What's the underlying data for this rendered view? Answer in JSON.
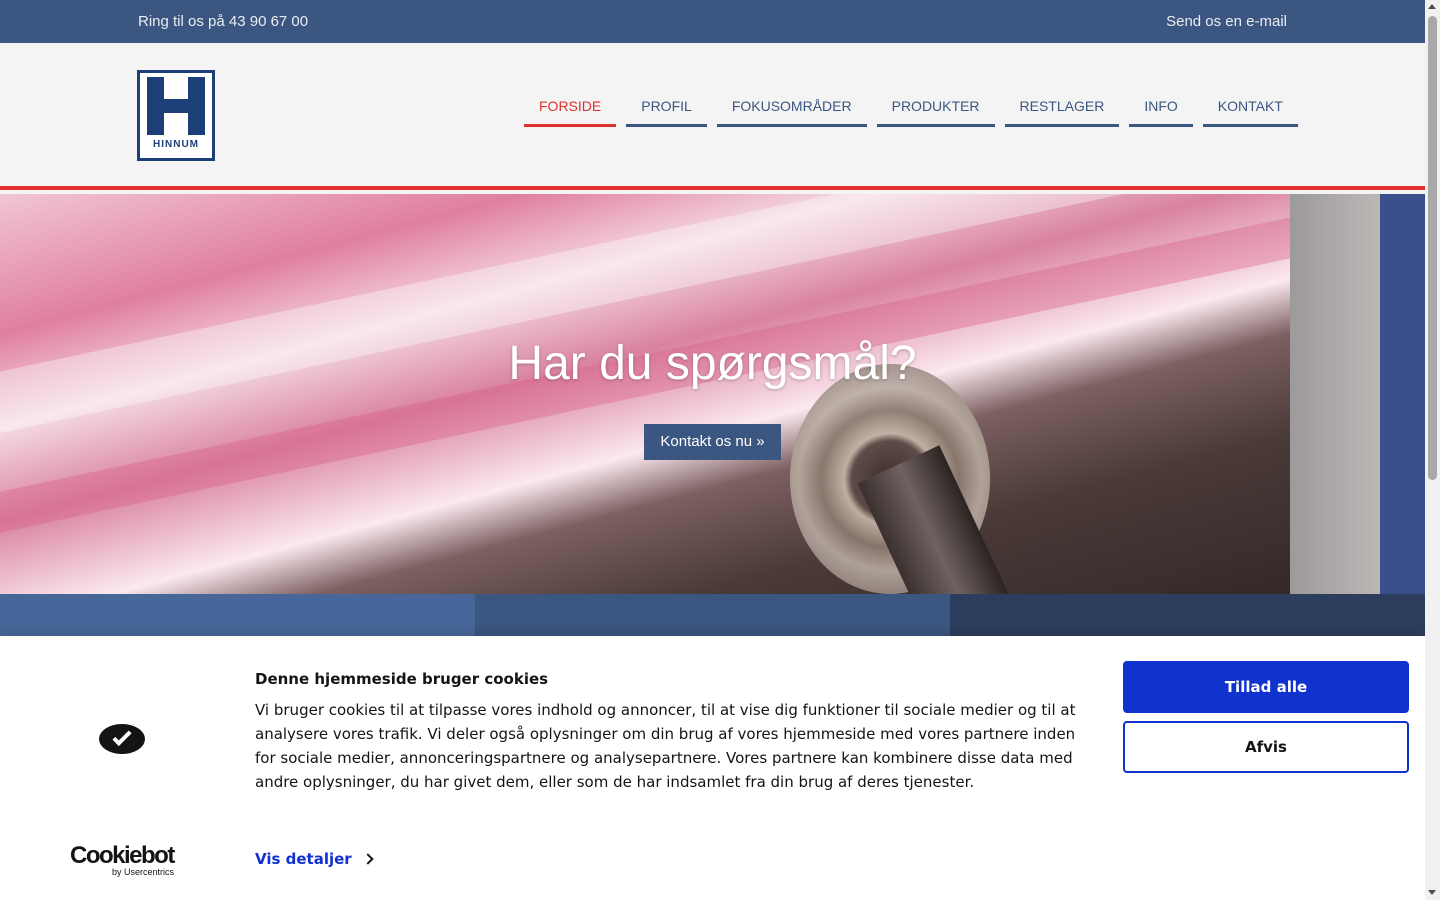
{
  "topbar": {
    "phone": "Ring til os på 43 90 67 00",
    "email": "Send os en e-mail"
  },
  "logo": {
    "name": "HINNUM"
  },
  "nav": {
    "items": [
      {
        "label": "FORSIDE",
        "active": true
      },
      {
        "label": "PROFIL"
      },
      {
        "label": "FOKUSOMRÅDER"
      },
      {
        "label": "PRODUKTER"
      },
      {
        "label": "RESTLAGER"
      },
      {
        "label": "INFO"
      },
      {
        "label": "KONTAKT"
      }
    ]
  },
  "hero": {
    "heading": "Har du spørgsmål?",
    "cta": "Kontakt os nu »"
  },
  "cookie": {
    "title": "Denne hjemmeside bruger cookies",
    "body": "Vi bruger cookies til at tilpasse vores indhold og annoncer, til at vise dig funktioner til sociale medier og til at analysere vores trafik. Vi deler også oplysninger om din brug af vores hjemmeside med vores partnere inden for sociale medier, annonceringspartnere og analysepartnere. Vores partnere kan kombinere disse data med andre oplysninger, du har givet dem, eller som de har indsamlet fra din brug af deres tjenester.",
    "details": "Vis detaljer",
    "allow": "Tillad alle",
    "deny": "Afvis",
    "brand": "Cookiebot",
    "brand_sub": "by Usercentrics"
  },
  "colors": {
    "primary": "#3b5680",
    "accent": "#e0312f",
    "cookie_blue": "#1032cf"
  }
}
